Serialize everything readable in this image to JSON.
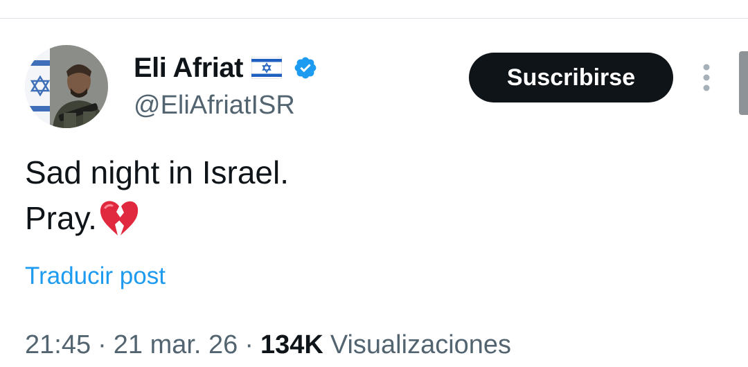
{
  "author": {
    "display_name": "Eli Afriat",
    "flag_icon": "israel-flag-icon",
    "verified_icon": "verified-badge-icon",
    "verified_color": "#1d9bf0",
    "handle": "@EliAfriatISR",
    "avatar_icon": "profile-avatar"
  },
  "actions": {
    "subscribe_label": "Suscribirse",
    "more_icon": "more-options-icon"
  },
  "post": {
    "lines": [
      "Sad night in Israel.",
      "Pray."
    ],
    "emoji_icon": "broken-heart-icon",
    "translate_label": "Traducir post"
  },
  "meta": {
    "time": "21:45",
    "separator": "·",
    "date": "21 mar. 26",
    "views_count": "134K",
    "views_label": "Visualizaciones"
  },
  "colors": {
    "text_primary": "#0f1419",
    "text_secondary": "#536471",
    "link": "#1d9bf0",
    "button_bg": "#0f1419"
  }
}
